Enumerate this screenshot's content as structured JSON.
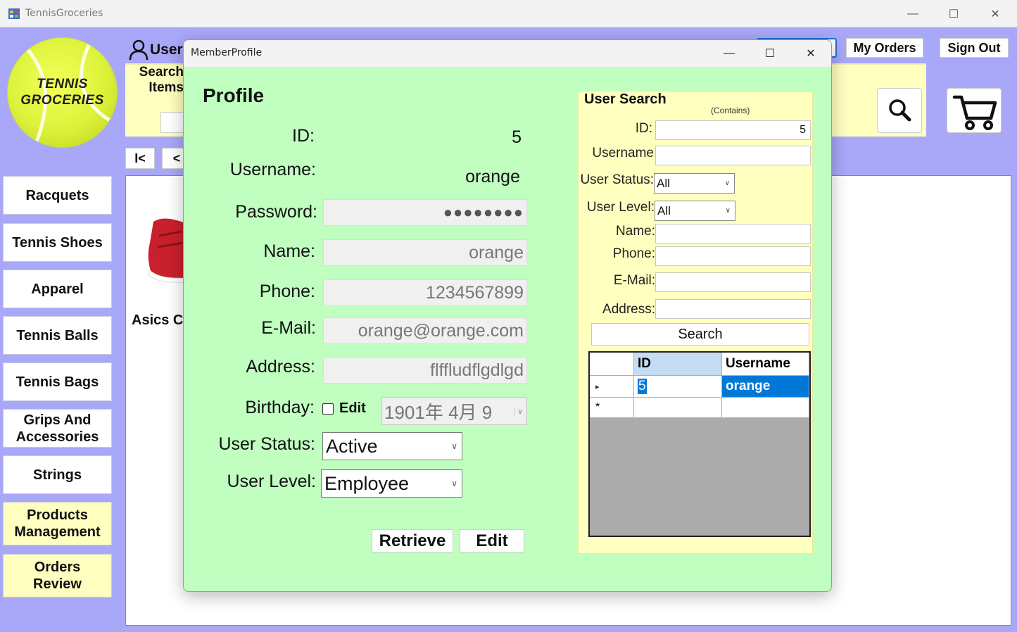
{
  "main_window": {
    "title": "TennisGroceries",
    "controls": {
      "minimize": "—",
      "maximize": "☐",
      "close": "✕"
    }
  },
  "logo": {
    "line1": "TENNIS",
    "line2": "GROCERIES"
  },
  "header": {
    "user_label": "User",
    "search_label": "Search Items",
    "my_orders": "My Orders",
    "sign_out": "Sign Out"
  },
  "pager": {
    "first": "I<",
    "prev": "<"
  },
  "nav": {
    "items": [
      {
        "label": "Racquets"
      },
      {
        "label": "Tennis Shoes"
      },
      {
        "label": "Apparel"
      },
      {
        "label": "Tennis Balls"
      },
      {
        "label": "Tennis Bags"
      },
      {
        "label": "Grips And Accessories"
      },
      {
        "label": "Strings"
      },
      {
        "label": "Products Management"
      },
      {
        "label": "Orders Review"
      }
    ]
  },
  "product": {
    "name": "Asics C"
  },
  "dialog": {
    "title": "MemberProfile",
    "controls": {
      "minimize": "—",
      "maximize": "☐",
      "close": "✕"
    },
    "profile_title": "Profile",
    "labels": {
      "id": "ID:",
      "username": "Username:",
      "password": "Password:",
      "name": "Name:",
      "phone": "Phone:",
      "email": "E-Mail:",
      "address": "Address:",
      "birthday": "Birthday:",
      "user_status": "User Status:",
      "user_level": "User Level:"
    },
    "values": {
      "id": "5",
      "username": "orange",
      "password": "●●●●●●●●",
      "name": "orange",
      "phone": "1234567899",
      "email": "orange@orange.com",
      "address": "flffludflgdlgd",
      "birthday": "1901年  4月  9",
      "birthday_edit_label": "Edit",
      "user_status": "Active",
      "user_level": "Employee"
    },
    "buttons": {
      "retrieve": "Retrieve",
      "edit": "Edit"
    }
  },
  "user_search": {
    "title": "User Search",
    "contains_hint": "(Contains)",
    "labels": {
      "id": "ID:",
      "username": "Username",
      "user_status": "User Status:",
      "user_level": "User Level:",
      "name": "Name:",
      "phone": "Phone:",
      "email": "E-Mail:",
      "address": "Address:"
    },
    "values": {
      "id": "5",
      "username": "",
      "user_status": "All",
      "user_level": "All",
      "name": "",
      "phone": "",
      "email": "",
      "address": ""
    },
    "search_button": "Search",
    "grid": {
      "columns": [
        "ID",
        "Username"
      ],
      "rows": [
        {
          "id": "5",
          "username": "orange"
        }
      ],
      "new_row_marker": "*",
      "current_row_marker": "▸"
    }
  },
  "colors": {
    "client_bg": "#a9a7f8",
    "dialog_bg": "#c0ffc0",
    "panel_yellow": "#ffffc0",
    "selection_blue": "#0078d7"
  }
}
